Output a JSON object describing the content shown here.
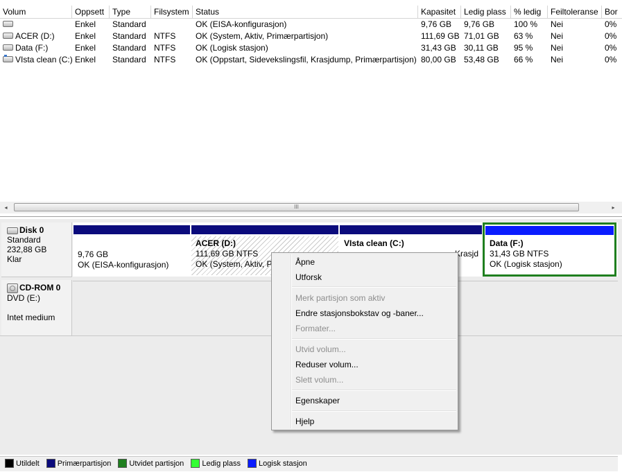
{
  "columns": [
    "Volum",
    "Oppsett",
    "Type",
    "Filsystem",
    "Status",
    "Kapasitet",
    "Ledig plass",
    "% ledig",
    "Feiltoleranse",
    "Bor"
  ],
  "volumes": [
    {
      "name": "",
      "layout": "Enkel",
      "type": "Standard",
      "fs": "",
      "status": "OK (EISA-konfigurasjon)",
      "capacity": "9,76 GB",
      "free": "9,76 GB",
      "pct": "100 %",
      "fault": "Nei",
      "ov": "0%"
    },
    {
      "name": "ACER (D:)",
      "layout": "Enkel",
      "type": "Standard",
      "fs": "NTFS",
      "status": "OK (System, Aktiv, Primærpartisjon)",
      "capacity": "111,69 GB",
      "free": "71,01 GB",
      "pct": "63 %",
      "fault": "Nei",
      "ov": "0%"
    },
    {
      "name": "Data (F:)",
      "layout": "Enkel",
      "type": "Standard",
      "fs": "NTFS",
      "status": "OK (Logisk stasjon)",
      "capacity": "31,43 GB",
      "free": "30,11 GB",
      "pct": "95 %",
      "fault": "Nei",
      "ov": "0%"
    },
    {
      "name": "VIsta clean (C:)",
      "layout": "Enkel",
      "type": "Standard",
      "fs": "NTFS",
      "status": "OK (Oppstart, Sidevekslingsfil, Krasjdump, Primærpartisjon)",
      "capacity": "80,00 GB",
      "free": "53,48 GB",
      "pct": "66 %",
      "fault": "Nei",
      "ov": "0%"
    }
  ],
  "scrollbar": {
    "grip": "III",
    "left_arrow": "◂",
    "right_arrow": "▸"
  },
  "disk0": {
    "name": "Disk 0",
    "type": "Standard",
    "size": "232,88 GB",
    "state": "Klar",
    "partitions": [
      {
        "title": "",
        "size": "9,76 GB",
        "status": "OK (EISA-konfigurasjon)"
      },
      {
        "title": "ACER  (D:)",
        "size": "111,69 GB NTFS",
        "status": "OK (System, Aktiv, P"
      },
      {
        "title": "VIsta clean  (C:)",
        "size": "",
        "status": "Krasjd"
      },
      {
        "title": "Data  (F:)",
        "size": "31,43 GB NTFS",
        "status": "OK (Logisk stasjon)"
      }
    ]
  },
  "cdrom": {
    "name": "CD-ROM 0",
    "drive": "DVD (E:)",
    "media": "Intet medium"
  },
  "menu": {
    "open": "Åpne",
    "explore": "Utforsk",
    "mark_active": "Merk partisjon som aktiv",
    "change_letter": "Endre stasjonsbokstav og -baner...",
    "format": "Formater...",
    "extend": "Utvid volum...",
    "shrink": "Reduser volum...",
    "delete": "Slett volum...",
    "properties": "Egenskaper",
    "help": "Hjelp"
  },
  "legend": [
    {
      "label": "Utildelt",
      "color": "#000000"
    },
    {
      "label": "Primærpartisjon",
      "color": "#0b0b7c"
    },
    {
      "label": "Utvidet partisjon",
      "color": "#1f7f1f"
    },
    {
      "label": "Ledig plass",
      "color": "#33ff33"
    },
    {
      "label": "Logisk stasjon",
      "color": "#0a1cff"
    }
  ]
}
